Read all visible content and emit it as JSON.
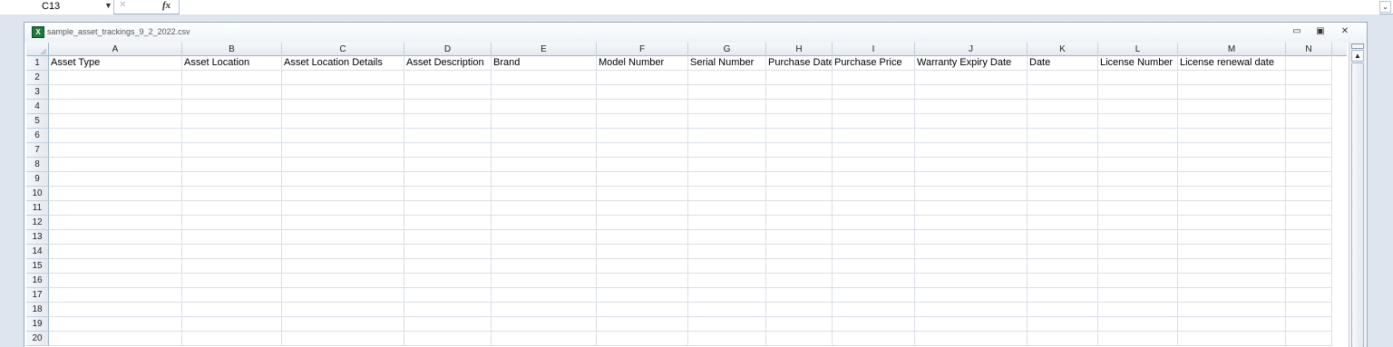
{
  "formula_bar": {
    "name_box": "C13",
    "dropdown_icon": "▼",
    "cancel_icon": "✕",
    "fx_label": "fx",
    "formula_value": "",
    "expand_icon": "⌄"
  },
  "workbook": {
    "title": "sample_asset_trackings_9_2_2022.csv",
    "icon_glyph": "X",
    "controls": {
      "minimize": "▭",
      "restore": "▣",
      "close": "✕"
    }
  },
  "columns": [
    "A",
    "B",
    "C",
    "D",
    "E",
    "F",
    "G",
    "H",
    "I",
    "J",
    "K",
    "L",
    "M",
    "N"
  ],
  "rows": [
    "1",
    "2",
    "3",
    "4",
    "5",
    "6",
    "7",
    "8",
    "9",
    "10",
    "11",
    "12",
    "13",
    "14",
    "15",
    "16",
    "17",
    "18",
    "19",
    "20"
  ],
  "header_row_values": [
    "Asset Type",
    "Asset Location",
    "Asset Location Details",
    "Asset Description",
    "Brand",
    "Model Number",
    "Serial Number",
    "Purchase Date",
    "Purchase Price",
    "Warranty Expiry Date",
    "Date",
    "License Number",
    "License renewal date",
    ""
  ],
  "colors": {
    "selected_cell_name": "C13",
    "grid_line": "#dadfe6",
    "header_border": "#9eb6ce"
  }
}
